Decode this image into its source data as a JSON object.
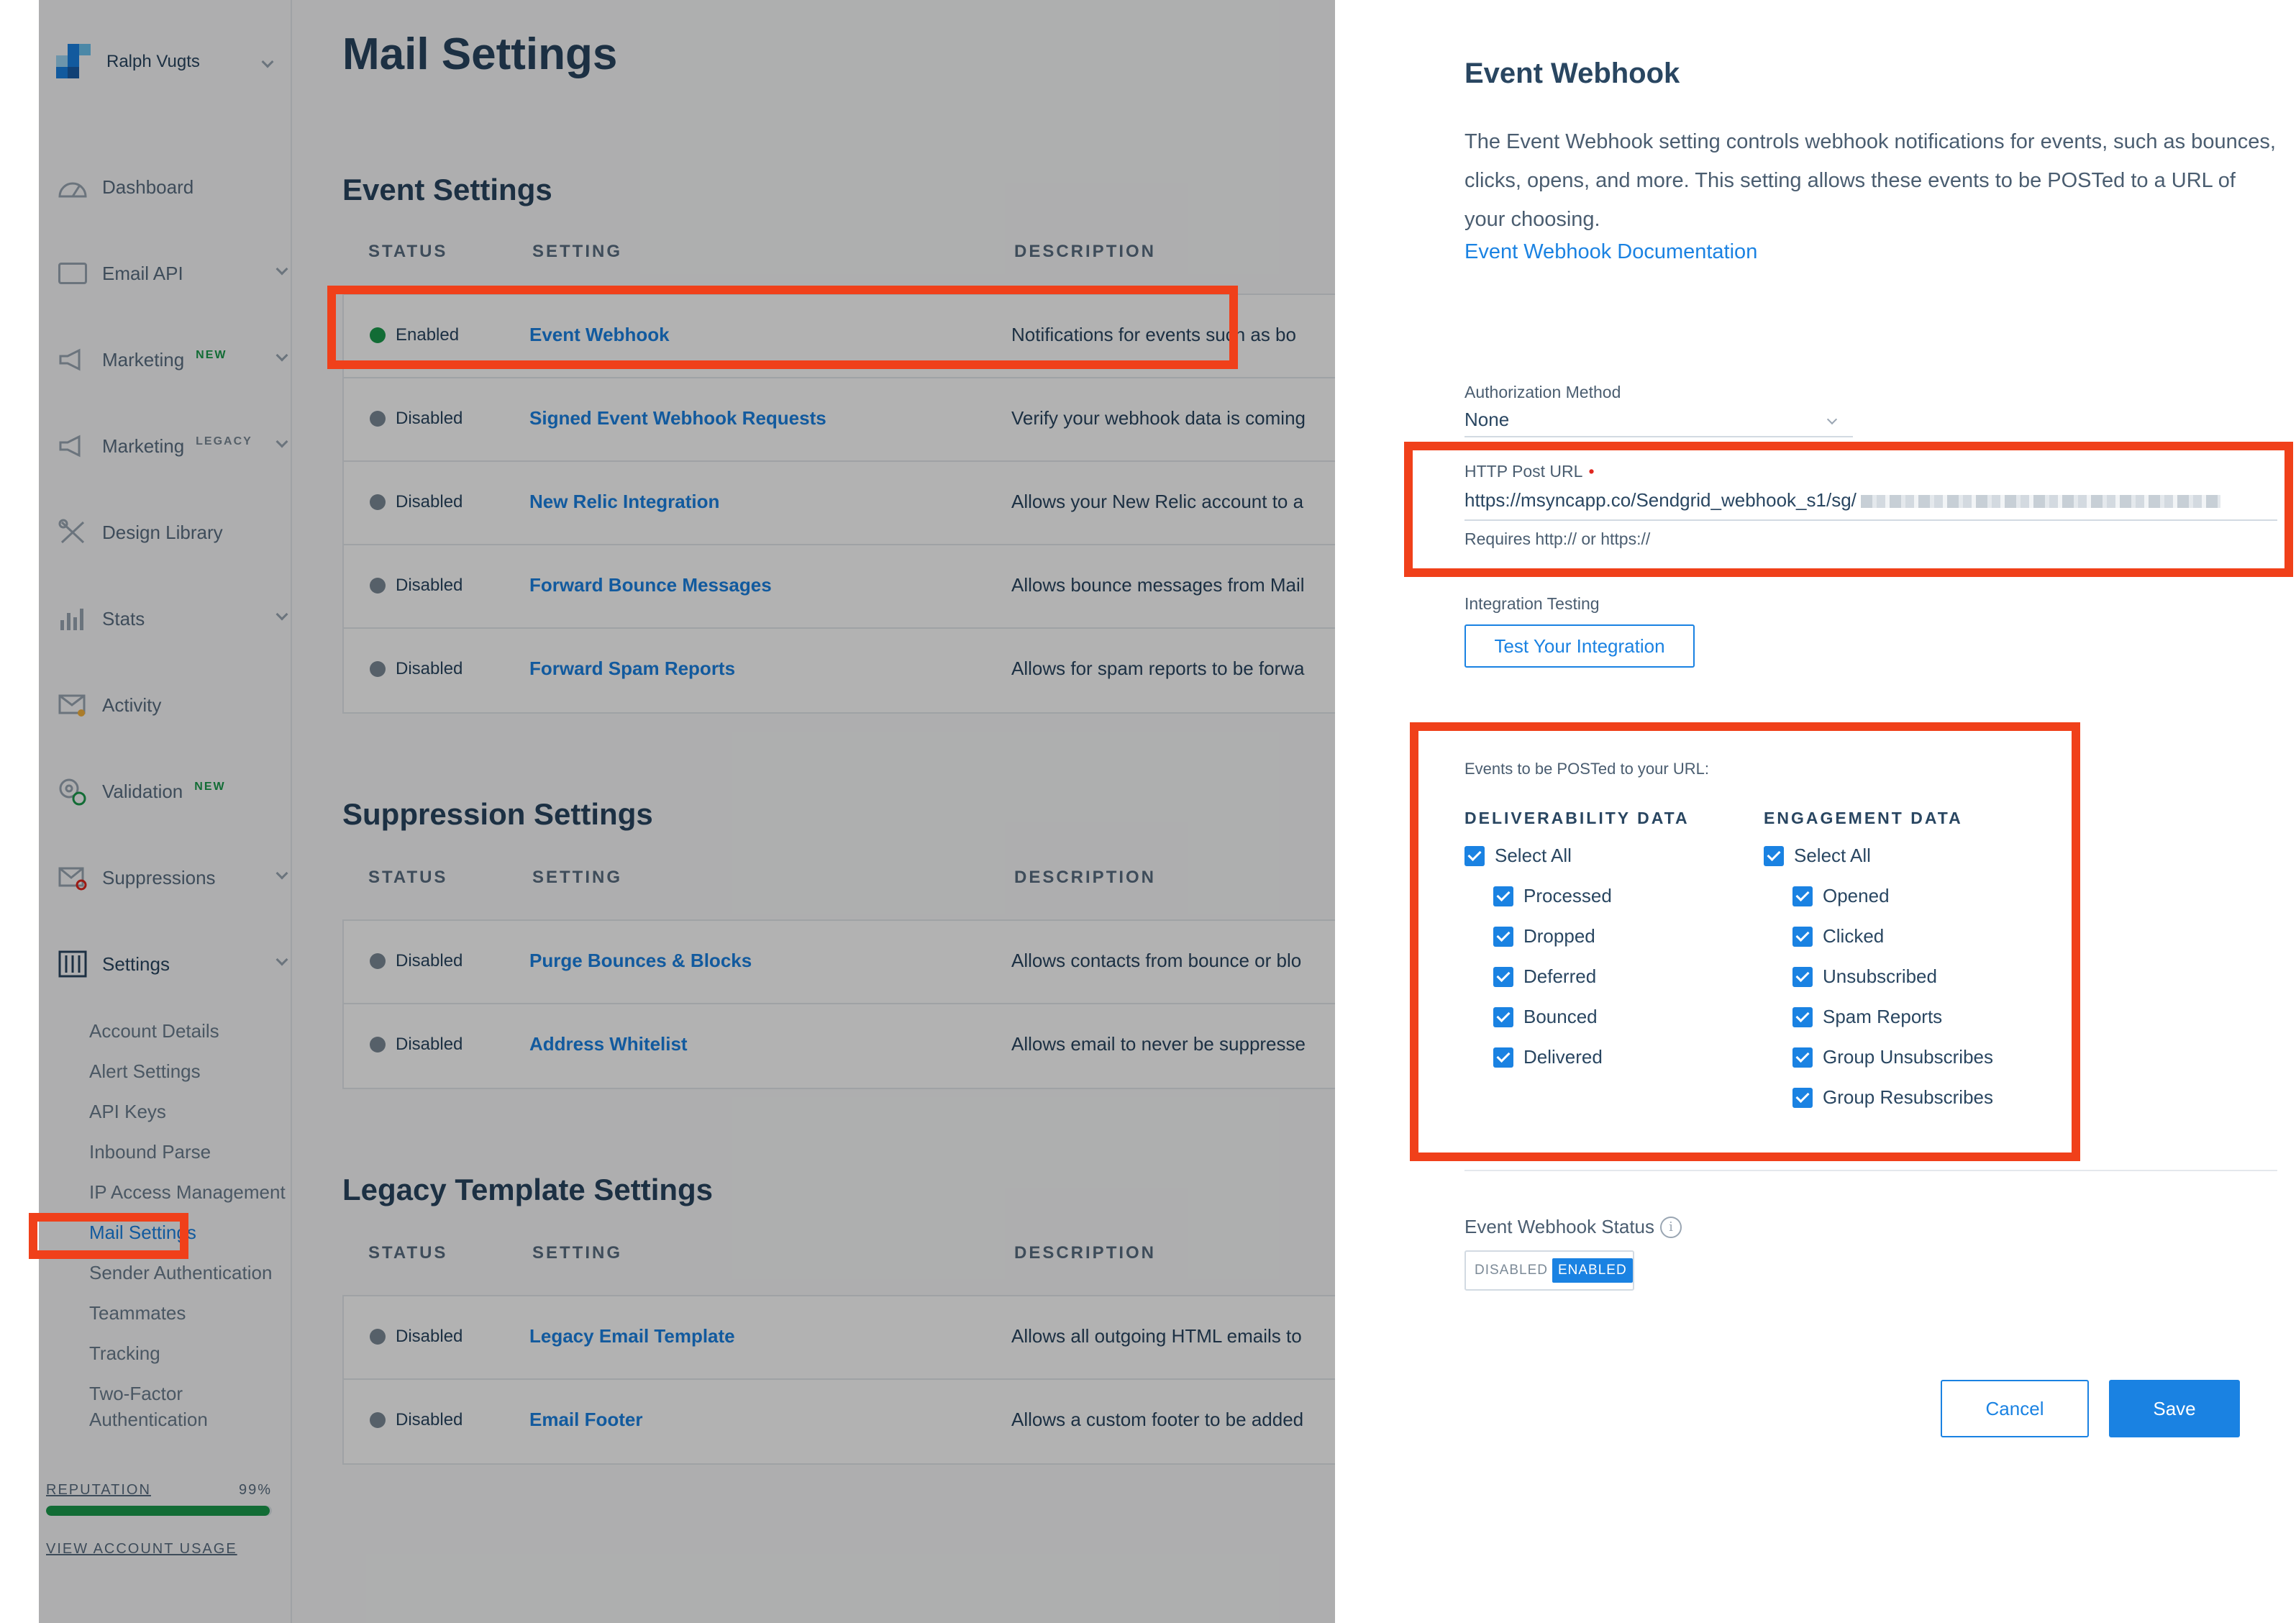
{
  "account": {
    "name": "Ralph Vugts"
  },
  "nav": [
    {
      "label": "Dashboard",
      "icon": "dashboard-icon"
    },
    {
      "label": "Email API",
      "icon": "email-api-icon"
    },
    {
      "label": "Marketing",
      "tag": "NEW",
      "icon": "megaphone-icon"
    },
    {
      "label": "Marketing",
      "tag": "LEGACY",
      "icon": "megaphone-icon"
    },
    {
      "label": "Design Library",
      "icon": "design-library-icon"
    },
    {
      "label": "Stats",
      "icon": "stats-icon"
    },
    {
      "label": "Activity",
      "icon": "activity-icon"
    },
    {
      "label": "Validation",
      "tag": "NEW",
      "icon": "validation-icon"
    },
    {
      "label": "Suppressions",
      "icon": "suppressions-icon"
    },
    {
      "label": "Settings",
      "icon": "settings-icon"
    }
  ],
  "settings_sub": [
    "Account Details",
    "Alert Settings",
    "API Keys",
    "Inbound Parse",
    "IP Access Management",
    "Mail Settings",
    "Sender Authentication",
    "Teammates",
    "Tracking",
    "Two-Factor",
    "Authentication"
  ],
  "reputation": {
    "label": "REPUTATION",
    "value": "99%",
    "fraction": 0.99
  },
  "usage_link": "VIEW ACCOUNT USAGE",
  "page": {
    "title": "Mail Settings"
  },
  "columns": {
    "status": "STATUS",
    "setting": "SETTING",
    "description": "DESCRIPTION"
  },
  "sections": [
    {
      "title": "Event Settings",
      "rows": [
        {
          "status": "Enabled",
          "setting": "Event Webhook",
          "description": "Notifications for events such as bo"
        },
        {
          "status": "Disabled",
          "setting": "Signed Event Webhook Requests",
          "description": "Verify your webhook data is coming"
        },
        {
          "status": "Disabled",
          "setting": "New Relic Integration",
          "description": "Allows your New Relic account to a"
        },
        {
          "status": "Disabled",
          "setting": "Forward Bounce Messages",
          "description": "Allows bounce messages from Mail"
        },
        {
          "status": "Disabled",
          "setting": "Forward Spam Reports",
          "description": "Allows for spam reports to be forwa"
        }
      ]
    },
    {
      "title": "Suppression Settings",
      "rows": [
        {
          "status": "Disabled",
          "setting": "Purge Bounces & Blocks",
          "description": "Allows contacts from bounce or blo"
        },
        {
          "status": "Disabled",
          "setting": "Address Whitelist",
          "description": "Allows email to never be suppresse"
        }
      ]
    },
    {
      "title": "Legacy Template Settings",
      "rows": [
        {
          "status": "Disabled",
          "setting": "Legacy Email Template",
          "description": "Allows all outgoing HTML emails to"
        },
        {
          "status": "Disabled",
          "setting": "Email Footer",
          "description": "Allows a custom footer to be added"
        }
      ]
    }
  ],
  "drawer": {
    "title": "Event Webhook",
    "intro": "The Event Webhook setting controls webhook notifications for events, such as bounces, clicks, opens, and more. This setting allows these events to be POSTed to a URL of your choosing.",
    "doc_link": "Event Webhook Documentation",
    "auth_label": "Authorization Method",
    "auth_value": "None",
    "url_label": "HTTP Post URL",
    "url_value": "https://msyncapp.co/Sendgrid_webhook_s1/sg/",
    "url_hint": "Requires http:// or https://",
    "testing_label": "Integration Testing",
    "testing_button": "Test Your Integration",
    "events_note": "Events to be POSTed to your URL:",
    "deliverability": {
      "title": "DELIVERABILITY DATA",
      "select_all": "Select All",
      "items": [
        "Processed",
        "Dropped",
        "Deferred",
        "Bounced",
        "Delivered"
      ]
    },
    "engagement": {
      "title": "ENGAGEMENT DATA",
      "select_all": "Select All",
      "items": [
        "Opened",
        "Clicked",
        "Unsubscribed",
        "Spam Reports",
        "Group Unsubscribes",
        "Group Resubscribes"
      ]
    },
    "status_label": "Event Webhook Status",
    "toggle_off": "DISABLED",
    "toggle_on": "ENABLED",
    "cancel": "Cancel",
    "save": "Save"
  },
  "colors": {
    "accent": "#1a82e2",
    "enabled": "#1a9b4c",
    "highlight": "#f0401a",
    "new_tag": "#1a9b4c",
    "legacy_tag": "#7c8a97"
  }
}
